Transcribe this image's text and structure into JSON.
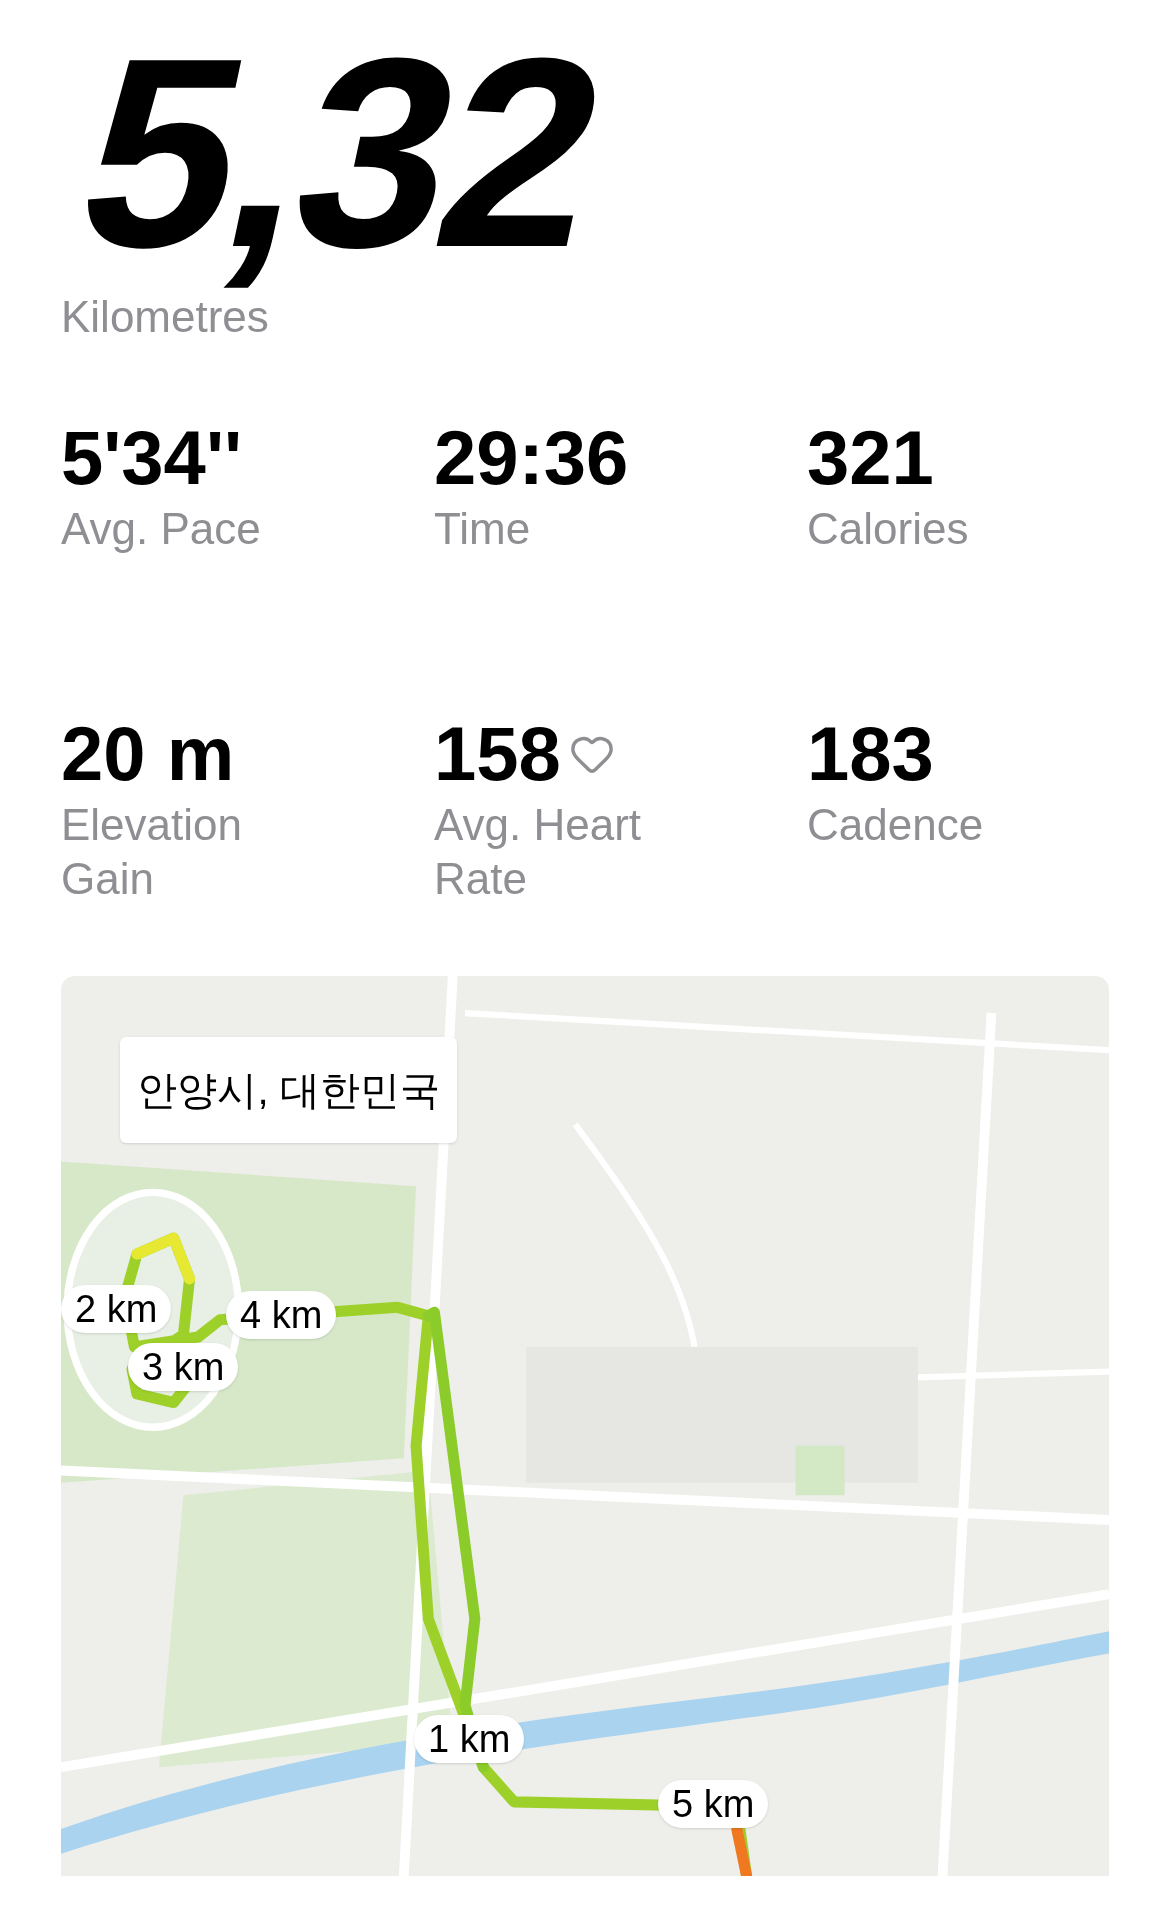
{
  "distance": {
    "value": "5,32",
    "unit": "Kilometres"
  },
  "stats": [
    {
      "kind": "plain",
      "value": "5'34''",
      "label": "Avg. Pace"
    },
    {
      "kind": "plain",
      "value": "29:36",
      "label": "Time"
    },
    {
      "kind": "plain",
      "value": "321",
      "label": "Calories"
    },
    {
      "kind": "plain",
      "value": "20 m",
      "label": "Elevation Gain"
    },
    {
      "kind": "heart",
      "value": "158",
      "label": "Avg. Heart Rate"
    },
    {
      "kind": "plain",
      "value": "183",
      "label": "Cadence"
    }
  ],
  "map": {
    "location": "안양시, 대한민국",
    "markers": [
      {
        "label": "2 km"
      },
      {
        "label": "4 km"
      },
      {
        "label": "3 km"
      },
      {
        "label": "1 km"
      },
      {
        "label": "5 km"
      }
    ]
  }
}
